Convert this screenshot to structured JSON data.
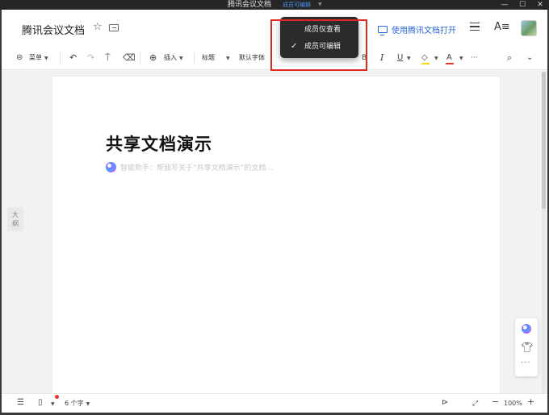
{
  "os_window": {
    "title": "腾讯会议文档",
    "permission_label": "成员可编辑",
    "controls": [
      "—",
      "☐",
      "✕"
    ]
  },
  "header": {
    "doc_title": "腾讯会议文档",
    "open_in_app_label": "使用腾讯文档打开",
    "font_size_icon_text": "A≡"
  },
  "toolbar": {
    "menu_label": "菜单",
    "insert_label": "插入",
    "heading_label": "标题",
    "font_label": "默认字体",
    "italic": "I",
    "underline": "U",
    "font_color": "A",
    "more": "···"
  },
  "doc": {
    "heading": "共享文档演示",
    "ai_prompt": "智能助手：帮我写关于“共享文档演示”的文档..."
  },
  "outline_tab": "大\n纲",
  "statusbar": {
    "word_count": "6 个字",
    "zoom": "100%"
  },
  "popup": {
    "items": [
      {
        "label": "成员仅查看",
        "checked": false
      },
      {
        "label": "成员可编辑",
        "checked": true
      }
    ]
  },
  "colors": {
    "accent": "#2a66d9",
    "highlight": "#f5d800",
    "font_color_bar": "#e8342e",
    "annotation_box": "#e0281e"
  }
}
